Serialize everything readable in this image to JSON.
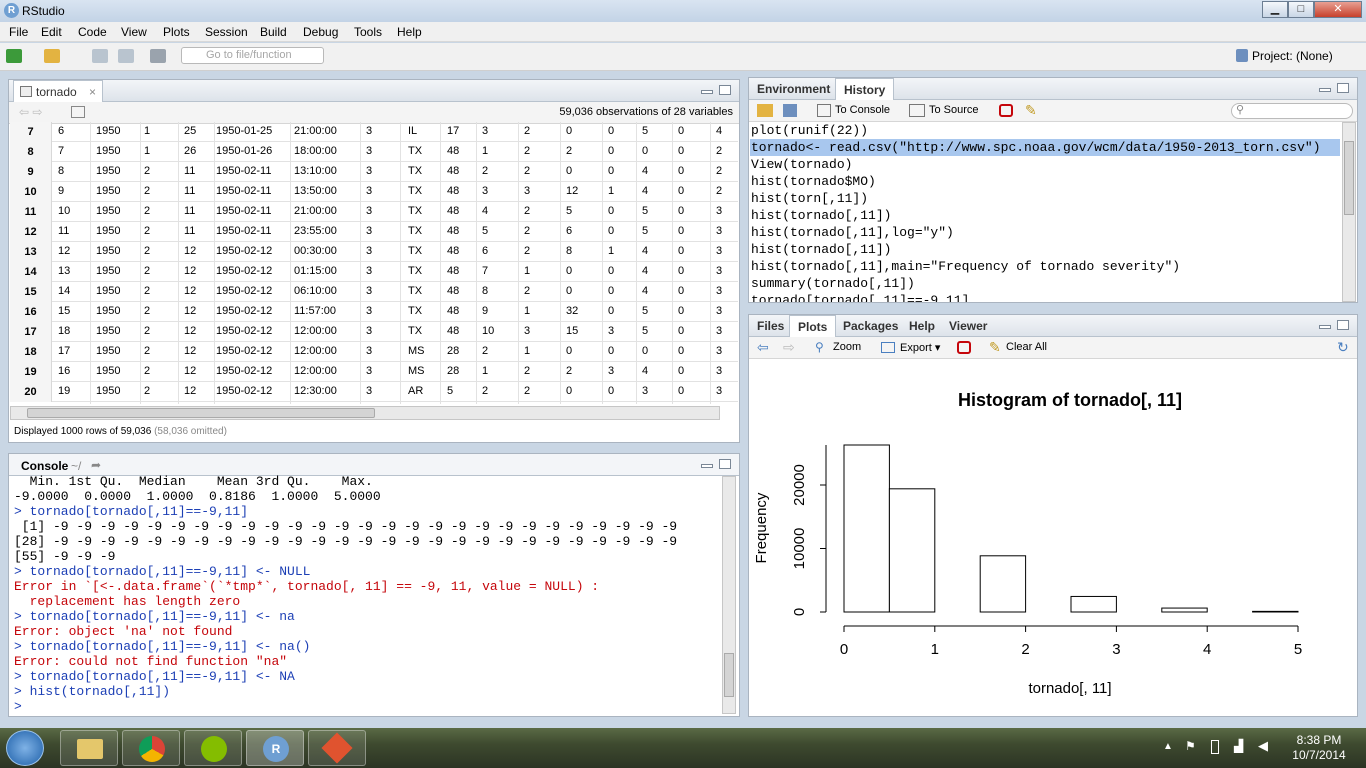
{
  "window": {
    "title": "RStudio",
    "minimize": "▁",
    "maximize": "□",
    "close": "✕"
  },
  "menu": [
    "File",
    "Edit",
    "Code",
    "View",
    "Plots",
    "Session",
    "Build",
    "Debug",
    "Tools",
    "Help"
  ],
  "toolbar": {
    "goto_placeholder": "Go to file/function",
    "project": "Project: (None)"
  },
  "data_viewer": {
    "tab": "tornado",
    "obs_info": "59,036 observations of 28 variables",
    "footer_main": "Displayed 1000 rows of 59,036",
    "footer_omitted": "(58,036 omitted)",
    "rows": [
      [
        "7",
        "6",
        "1950",
        "1",
        "25",
        "1950-01-25",
        "21:00:00",
        "3",
        "IL",
        "17",
        "3",
        "2",
        "0",
        "0",
        "5",
        "0",
        "4"
      ],
      [
        "8",
        "7",
        "1950",
        "1",
        "26",
        "1950-01-26",
        "18:00:00",
        "3",
        "TX",
        "48",
        "1",
        "2",
        "2",
        "0",
        "0",
        "0",
        "2"
      ],
      [
        "9",
        "8",
        "1950",
        "2",
        "11",
        "1950-02-11",
        "13:10:00",
        "3",
        "TX",
        "48",
        "2",
        "2",
        "0",
        "0",
        "4",
        "0",
        "2"
      ],
      [
        "10",
        "9",
        "1950",
        "2",
        "11",
        "1950-02-11",
        "13:50:00",
        "3",
        "TX",
        "48",
        "3",
        "3",
        "12",
        "1",
        "4",
        "0",
        "2"
      ],
      [
        "11",
        "10",
        "1950",
        "2",
        "11",
        "1950-02-11",
        "21:00:00",
        "3",
        "TX",
        "48",
        "4",
        "2",
        "5",
        "0",
        "5",
        "0",
        "3"
      ],
      [
        "12",
        "11",
        "1950",
        "2",
        "11",
        "1950-02-11",
        "23:55:00",
        "3",
        "TX",
        "48",
        "5",
        "2",
        "6",
        "0",
        "5",
        "0",
        "3"
      ],
      [
        "13",
        "12",
        "1950",
        "2",
        "12",
        "1950-02-12",
        "00:30:00",
        "3",
        "TX",
        "48",
        "6",
        "2",
        "8",
        "1",
        "4",
        "0",
        "3"
      ],
      [
        "14",
        "13",
        "1950",
        "2",
        "12",
        "1950-02-12",
        "01:15:00",
        "3",
        "TX",
        "48",
        "7",
        "1",
        "0",
        "0",
        "4",
        "0",
        "3"
      ],
      [
        "15",
        "14",
        "1950",
        "2",
        "12",
        "1950-02-12",
        "06:10:00",
        "3",
        "TX",
        "48",
        "8",
        "2",
        "0",
        "0",
        "4",
        "0",
        "3"
      ],
      [
        "16",
        "15",
        "1950",
        "2",
        "12",
        "1950-02-12",
        "11:57:00",
        "3",
        "TX",
        "48",
        "9",
        "1",
        "32",
        "0",
        "5",
        "0",
        "3"
      ],
      [
        "17",
        "18",
        "1950",
        "2",
        "12",
        "1950-02-12",
        "12:00:00",
        "3",
        "TX",
        "48",
        "10",
        "3",
        "15",
        "3",
        "5",
        "0",
        "3"
      ],
      [
        "18",
        "17",
        "1950",
        "2",
        "12",
        "1950-02-12",
        "12:00:00",
        "3",
        "MS",
        "28",
        "2",
        "1",
        "0",
        "0",
        "0",
        "0",
        "3"
      ],
      [
        "19",
        "16",
        "1950",
        "2",
        "12",
        "1950-02-12",
        "12:00:00",
        "3",
        "MS",
        "28",
        "1",
        "2",
        "2",
        "3",
        "4",
        "0",
        "3"
      ],
      [
        "20",
        "19",
        "1950",
        "2",
        "12",
        "1950-02-12",
        "12:30:00",
        "3",
        "AR",
        "5",
        "2",
        "2",
        "0",
        "0",
        "3",
        "0",
        "3"
      ]
    ]
  },
  "console": {
    "title": "Console",
    "path": "~/",
    "lines": [
      {
        "t": "  Min. 1st Qu.  Median    Mean 3rd Qu.    Max. ",
        "c": ""
      },
      {
        "t": "-9.0000  0.0000  1.0000  0.8186  1.0000  5.0000",
        "c": ""
      },
      {
        "t": "> tornado[tornado[,11]==-9,11]",
        "c": "blue"
      },
      {
        "t": " [1] -9 -9 -9 -9 -9 -9 -9 -9 -9 -9 -9 -9 -9 -9 -9 -9 -9 -9 -9 -9 -9 -9 -9 -9 -9 -9 -9",
        "c": ""
      },
      {
        "t": "[28] -9 -9 -9 -9 -9 -9 -9 -9 -9 -9 -9 -9 -9 -9 -9 -9 -9 -9 -9 -9 -9 -9 -9 -9 -9 -9 -9",
        "c": ""
      },
      {
        "t": "[55] -9 -9 -9",
        "c": ""
      },
      {
        "t": "> tornado[tornado[,11]==-9,11] <- NULL",
        "c": "blue"
      },
      {
        "t": "Error in `[<-.data.frame`(`*tmp*`, tornado[, 11] == -9, 11, value = NULL) : ",
        "c": "red"
      },
      {
        "t": "  replacement has length zero",
        "c": "red"
      },
      {
        "t": "> tornado[tornado[,11]==-9,11] <- na",
        "c": "blue"
      },
      {
        "t": "Error: object 'na' not found",
        "c": "red"
      },
      {
        "t": "> tornado[tornado[,11]==-9,11] <- na()",
        "c": "blue"
      },
      {
        "t": "Error: could not find function \"na\"",
        "c": "red"
      },
      {
        "t": "> tornado[tornado[,11]==-9,11] <- NA",
        "c": "blue"
      },
      {
        "t": "> hist(tornado[,11])",
        "c": "blue"
      },
      {
        "t": "> ",
        "c": "blue"
      }
    ]
  },
  "env_pane": {
    "tabs": [
      "Environment",
      "History"
    ],
    "to_console": "To Console",
    "to_source": "To Source",
    "history": [
      "plot(runif(22))",
      "tornado<- read.csv(\"http://www.spc.noaa.gov/wcm/data/1950-2013_torn.csv\")",
      "View(tornado)",
      "hist(tornado$MO)",
      "hist(torn[,11])",
      "hist(tornado[,11])",
      "hist(tornado[,11],log=\"y\")",
      "hist(tornado[,11])",
      "hist(tornado[,11],main=\"Frequency of tornado severity\")",
      "summary(tornado[,11])",
      "tornado[tornado[,11]==-9,11]"
    ],
    "selected_index": 1
  },
  "files_pane": {
    "tabs": [
      "Files",
      "Plots",
      "Packages",
      "Help",
      "Viewer"
    ],
    "zoom": "Zoom",
    "export": "Export",
    "clear_all": "Clear All"
  },
  "chart_data": {
    "type": "bar",
    "title": "Histogram of tornado[, 11]",
    "xlabel": "tornado[, 11]",
    "ylabel": "Frequency",
    "bins": [
      [
        0,
        0.5
      ],
      [
        0.5,
        1
      ],
      [
        1.5,
        2
      ],
      [
        2.5,
        3
      ],
      [
        3.5,
        4
      ],
      [
        4.5,
        5
      ]
    ],
    "values": [
      26300,
      19400,
      8850,
      2450,
      620,
      100
    ],
    "xticks": [
      "0",
      "1",
      "2",
      "3",
      "4",
      "5"
    ],
    "yticks": [
      "0",
      "10000",
      "20000"
    ],
    "xlim": [
      0,
      5
    ],
    "ylim": [
      0,
      26300
    ]
  },
  "taskbar": {
    "time": "8:38 PM",
    "date": "10/7/2014"
  }
}
